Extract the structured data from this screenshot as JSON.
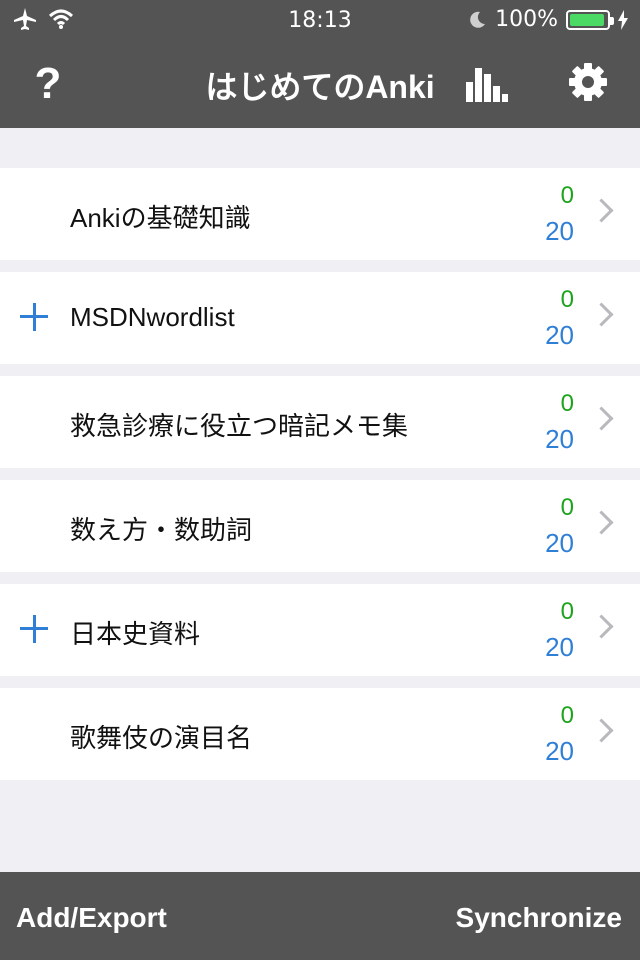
{
  "status": {
    "time": "18:13",
    "battery_percent": "100%",
    "battery_level": 1.0,
    "icons": [
      "airplane-icon",
      "wifi-icon",
      "moon-icon",
      "battery-icon",
      "charging-icon"
    ]
  },
  "nav": {
    "title": "はじめてのAnki",
    "help_label": "?",
    "icons": [
      "help-icon",
      "stats-icon",
      "settings-icon"
    ]
  },
  "decks": [
    {
      "name": "Ankiの基礎知識",
      "due": "0",
      "new": "20",
      "expandable": false
    },
    {
      "name": "MSDNwordlist",
      "due": "0",
      "new": "20",
      "expandable": true
    },
    {
      "name": "救急診療に役立つ暗記メモ集",
      "due": "0",
      "new": "20",
      "expandable": false
    },
    {
      "name": "数え方・数助詞",
      "due": "0",
      "new": "20",
      "expandable": false
    },
    {
      "name": "日本史資料",
      "due": "0",
      "new": "20",
      "expandable": true
    },
    {
      "name": "歌舞伎の演目名",
      "due": "0",
      "new": "20",
      "expandable": false
    }
  ],
  "toolbar": {
    "add_label": "Add/Export",
    "sync_label": "Synchronize"
  },
  "colors": {
    "bar": "#545454",
    "background": "#efeff4",
    "due": "#1fa31f",
    "new": "#2f7fd6",
    "battery": "#4cd964"
  }
}
